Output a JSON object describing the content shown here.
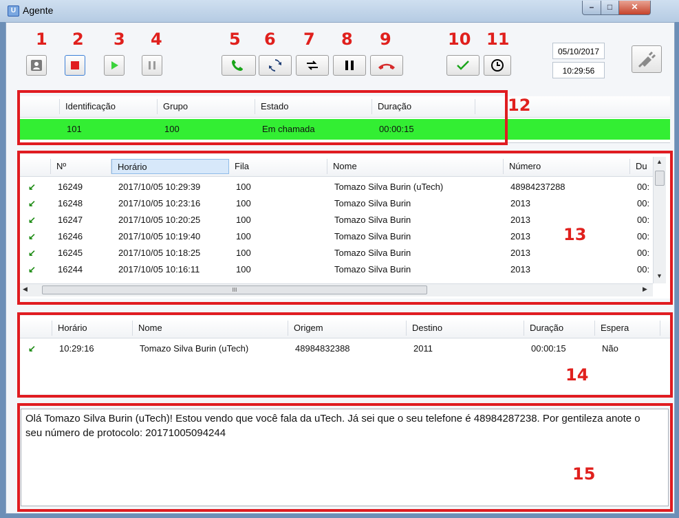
{
  "window": {
    "title": "Agente",
    "icon_glyph": "U"
  },
  "toolbar": {
    "numbers": [
      "1",
      "2",
      "3",
      "4",
      "5",
      "6",
      "7",
      "8",
      "9",
      "10",
      "11",
      "12",
      "13",
      "14",
      "15"
    ],
    "date": "05/10/2017",
    "time": "10:29:56"
  },
  "agent_table": {
    "headers": [
      "Identificação",
      "Grupo",
      "Estado",
      "Duração"
    ],
    "row": {
      "id": "101",
      "grupo": "100",
      "estado": "Em chamada",
      "duracao": "00:00:15"
    },
    "row_color": "#33ee33"
  },
  "queue_table": {
    "headers": [
      "Nº",
      "Horário",
      "Fila",
      "Nome",
      "Número",
      "Du"
    ],
    "rows": [
      {
        "n": "16249",
        "horario": "2017/10/05 10:29:39",
        "fila": "100",
        "nome": "Tomazo Silva Burin (uTech)",
        "numero": "48984237288",
        "du": "00:"
      },
      {
        "n": "16248",
        "horario": "2017/10/05 10:23:16",
        "fila": "100",
        "nome": "Tomazo Silva Burin",
        "numero": "2013",
        "du": "00:"
      },
      {
        "n": "16247",
        "horario": "2017/10/05 10:20:25",
        "fila": "100",
        "nome": "Tomazo Silva Burin",
        "numero": "2013",
        "du": "00:"
      },
      {
        "n": "16246",
        "horario": "2017/10/05 10:19:40",
        "fila": "100",
        "nome": "Tomazo Silva Burin",
        "numero": "2013",
        "du": "00:"
      },
      {
        "n": "16245",
        "horario": "2017/10/05 10:18:25",
        "fila": "100",
        "nome": "Tomazo Silva Burin",
        "numero": "2013",
        "du": "00:"
      },
      {
        "n": "16244",
        "horario": "2017/10/05 10:16:11",
        "fila": "100",
        "nome": "Tomazo Silva Burin",
        "numero": "2013",
        "du": "00:"
      }
    ],
    "scroll_thumb_glyph": "III"
  },
  "call_table": {
    "headers": [
      "Horário",
      "Nome",
      "Origem",
      "Destino",
      "Duração",
      "Espera"
    ],
    "row": {
      "horario": "10:29:16",
      "nome": "Tomazo Silva Burin (uTech)",
      "origem": "48984832388",
      "destino": "2011",
      "duracao": "00:00:15",
      "espera": "Não"
    }
  },
  "script_text": "Olá Tomazo Silva Burin (uTech)! Estou vendo que você fala da uTech. Já sei que o seu telefone é 48984287238. Por gentileza anote o seu número de protocolo: 20171005094244",
  "colors": {
    "red": "#e01c21",
    "green_call": "#1aa51a",
    "hangup": "#d62b2b"
  }
}
